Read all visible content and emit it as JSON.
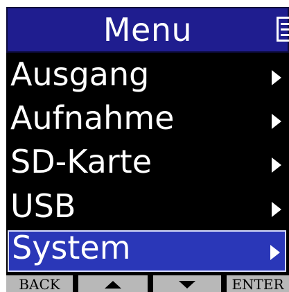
{
  "title": "Menu",
  "colors": {
    "background": "#000000",
    "title_bar": "#1f1d8f",
    "selection": "#2a37b8",
    "selection_border": "#d8dcff",
    "text": "#ffffff",
    "softkey": "#b8b8b8"
  },
  "header_icon": "list-icon",
  "menu": {
    "selected_index": 4,
    "items": [
      {
        "label": "Ausgang",
        "icon": "chevron-right-icon"
      },
      {
        "label": "Aufnahme",
        "icon": "chevron-right-icon"
      },
      {
        "label": "SD-Karte",
        "icon": "chevron-right-icon"
      },
      {
        "label": "USB",
        "icon": "chevron-right-icon"
      },
      {
        "label": "System",
        "icon": "chevron-right-icon"
      }
    ]
  },
  "softkeys": [
    {
      "label": "BACK"
    },
    {
      "icon": "up-triangle-icon"
    },
    {
      "icon": "down-triangle-icon"
    },
    {
      "label": "ENTER"
    }
  ]
}
